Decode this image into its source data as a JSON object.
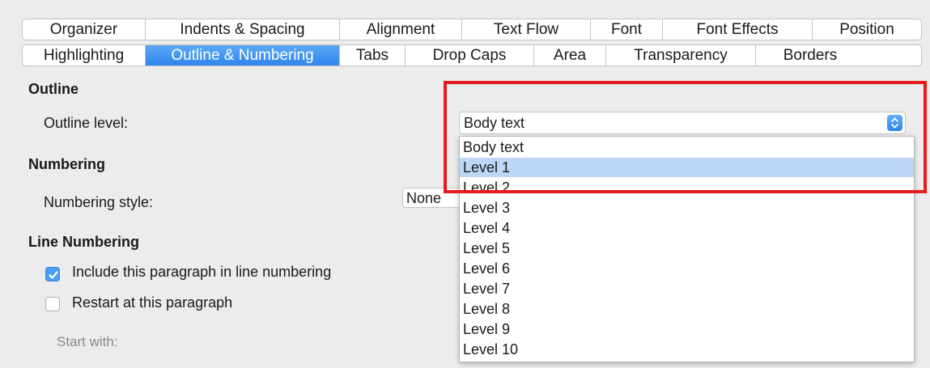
{
  "tabs": {
    "row1": [
      "Organizer",
      "Indents & Spacing",
      "Alignment",
      "Text Flow",
      "Font",
      "Font Effects",
      "Position"
    ],
    "row2": [
      "Highlighting",
      "Outline & Numbering",
      "Tabs",
      "Drop Caps",
      "Area",
      "Transparency",
      "Borders"
    ],
    "active": "Outline & Numbering"
  },
  "outline": {
    "heading": "Outline",
    "level_label": "Outline level:",
    "selected": "Body text",
    "options": [
      "Body text",
      "Level 1",
      "Level 2",
      "Level 3",
      "Level 4",
      "Level 5",
      "Level 6",
      "Level 7",
      "Level 8",
      "Level 9",
      "Level 10"
    ],
    "highlighted_option": "Level 1"
  },
  "numbering": {
    "heading": "Numbering",
    "style_label": "Numbering style:",
    "style_value": "None"
  },
  "line_numbering": {
    "heading": "Line Numbering",
    "include_label": "Include this paragraph in line numbering",
    "include_checked": true,
    "restart_label": "Restart at this paragraph",
    "restart_checked": false,
    "start_with_label": "Start with:"
  },
  "colors": {
    "accent": "#2f86ec",
    "highlight_row": "#bcd7f7",
    "annotation_box": "#e41c1c"
  }
}
